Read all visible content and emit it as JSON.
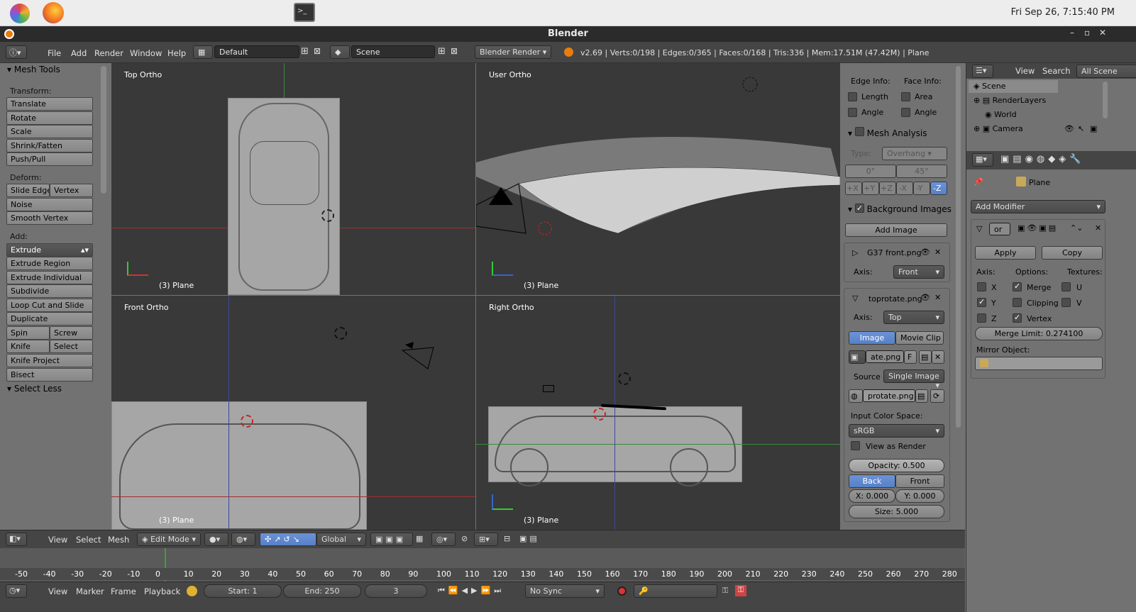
{
  "os": {
    "clock": "Fri Sep 26,  7:15:40 PM"
  },
  "window": {
    "title": "Blender"
  },
  "info": {
    "menus": [
      "File",
      "Add",
      "Render",
      "Window",
      "Help"
    ],
    "screen_layout": "Default",
    "scene": "Scene",
    "engine": "Blender Render",
    "stats": "v2.69 | Verts:0/198 | Edges:0/365 | Faces:0/168 | Tris:336 | Mem:17.51M (47.42M) | Plane"
  },
  "tools": {
    "header": "Mesh Tools",
    "transform_label": "Transform:",
    "translate": "Translate",
    "rotate": "Rotate",
    "scale": "Scale",
    "shrink_fatten": "Shrink/Fatten",
    "push_pull": "Push/Pull",
    "deform_label": "Deform:",
    "slide_edge": "Slide Edge",
    "vertex": "Vertex",
    "noise": "Noise",
    "smooth_vertex": "Smooth Vertex",
    "add_label": "Add:",
    "extrude": "Extrude",
    "extrude_region": "Extrude Region",
    "extrude_individual": "Extrude Individual",
    "subdivide": "Subdivide",
    "loop_cut": "Loop Cut and Slide",
    "duplicate": "Duplicate",
    "spin": "Spin",
    "screw": "Screw",
    "knife": "Knife",
    "select": "Select",
    "knife_project": "Knife Project",
    "bisect": "Bisect",
    "select_less": "Select Less"
  },
  "viewports": {
    "top": {
      "name": "Top Ortho",
      "object": "(3) Plane"
    },
    "user": {
      "name": "User Ortho",
      "object": "(3) Plane"
    },
    "front": {
      "name": "Front Ortho",
      "object": "(3) Plane"
    },
    "right": {
      "name": "Right Ortho",
      "object": "(3) Plane"
    }
  },
  "npanel": {
    "edge_info": "Edge Info:",
    "face_info": "Face Info:",
    "length": "Length",
    "area": "Area",
    "angle1": "Angle",
    "angle2": "Angle",
    "mesh_analysis": "Mesh Analysis",
    "type_label": "Type:",
    "type_value": "Overhang",
    "deg0": "0°",
    "deg45": "45°",
    "axes": [
      "+X",
      "+Y",
      "+Z",
      "-X",
      "-Y",
      "-Z"
    ],
    "bg_images": "Background Images",
    "add_image": "Add Image",
    "img1_name": "G37 front.png",
    "axis_label": "Axis:",
    "img1_axis": "Front",
    "img2_name": "toprotate.png",
    "img2_axis": "Top",
    "image_tab": "Image",
    "movieclip_tab": "Movie Clip",
    "img_field": "ate.png",
    "img_f": "F",
    "source_label": "Source",
    "source_value": "Single Image",
    "file_field": "protate.png",
    "input_cs": "Input Color Space:",
    "cs_value": "sRGB",
    "view_as_render": "View as Render",
    "opacity": "Opacity: 0.500",
    "back": "Back",
    "front": "Front",
    "x": "X: 0.000",
    "y": "Y: 0.000",
    "size": "Size: 5.000"
  },
  "outliner": {
    "view": "View",
    "search": "Search",
    "all_scenes": "All Scene",
    "items": [
      "Scene",
      "RenderLayers",
      "World",
      "Camera"
    ]
  },
  "properties": {
    "object": "Plane",
    "add_modifier": "Add Modifier",
    "mod_name": "or",
    "apply": "Apply",
    "copy": "Copy",
    "axis": "Axis:",
    "options": "Options:",
    "textures": "Textures:",
    "x": "X",
    "y": "Y",
    "z": "Z",
    "merge": "Merge",
    "clipping": "Clipping",
    "vertex": "Vertex",
    "u": "U",
    "v": "V",
    "merge_limit": "Merge Limit: 0.274100",
    "mirror_object": "Mirror Object:"
  },
  "view3d_header": {
    "view": "View",
    "select": "Select",
    "mesh": "Mesh",
    "mode": "Edit Mode",
    "orientation": "Global"
  },
  "timeline": {
    "ticks": [
      "-50",
      "-40",
      "-30",
      "-20",
      "-10",
      "0",
      "10",
      "20",
      "30",
      "40",
      "50",
      "60",
      "70",
      "80",
      "90",
      "100",
      "110",
      "120",
      "130",
      "140",
      "150",
      "160",
      "170",
      "180",
      "190",
      "200",
      "210",
      "220",
      "230",
      "240",
      "250",
      "260",
      "270",
      "280"
    ],
    "current_frame_marker": 3
  },
  "timeline_header": {
    "view": "View",
    "marker": "Marker",
    "frame": "Frame",
    "playback": "Playback",
    "start": "Start: 1",
    "end": "End: 250",
    "current": "3",
    "sync": "No Sync"
  }
}
